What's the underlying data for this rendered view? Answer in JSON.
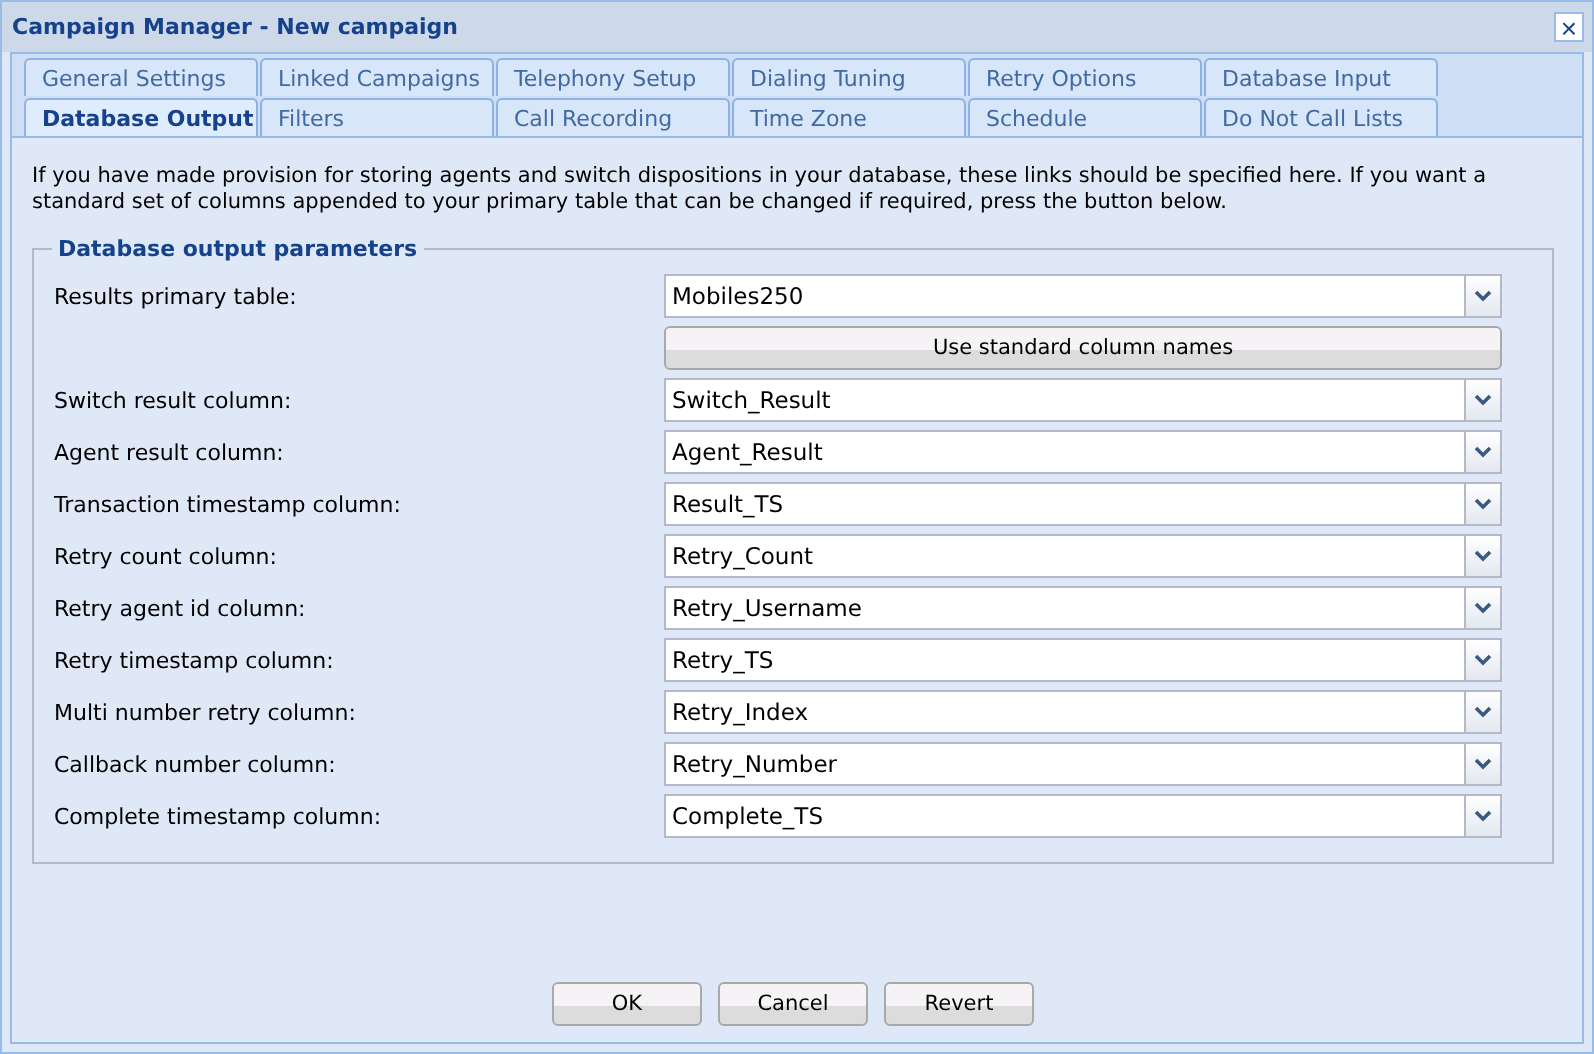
{
  "window": {
    "title": "Campaign Manager - New campaign",
    "close": "×"
  },
  "tab_rows": [
    [
      {
        "label": "General Settings",
        "selected": false
      },
      {
        "label": "Linked Campaigns",
        "selected": false
      },
      {
        "label": "Telephony Setup",
        "selected": false
      },
      {
        "label": "Dialing Tuning",
        "selected": false
      },
      {
        "label": "Retry Options",
        "selected": false
      },
      {
        "label": "Database Input",
        "selected": false
      }
    ],
    [
      {
        "label": "Database Output",
        "selected": true
      },
      {
        "label": "Filters",
        "selected": false
      },
      {
        "label": "Call Recording",
        "selected": false
      },
      {
        "label": "Time Zone",
        "selected": false
      },
      {
        "label": "Schedule",
        "selected": false
      },
      {
        "label": "Do Not Call Lists",
        "selected": false
      }
    ]
  ],
  "intro": "If you have made provision for storing agents and switch dispositions in your database, these links should be specified here. If you want a standard set of columns appended to your primary table that can be changed if required, press the button below.",
  "group": {
    "title": "Database output parameters",
    "fields": [
      {
        "kind": "select",
        "label": "Results primary table:",
        "value": "Mobiles250"
      },
      {
        "kind": "button",
        "label": "Use standard column names"
      },
      {
        "kind": "select",
        "label": "Switch result column:",
        "value": "Switch_Result"
      },
      {
        "kind": "select",
        "label": "Agent result column:",
        "value": "Agent_Result"
      },
      {
        "kind": "select",
        "label": "Transaction timestamp column:",
        "value": "Result_TS"
      },
      {
        "kind": "select",
        "label": "Retry count column:",
        "value": "Retry_Count"
      },
      {
        "kind": "select",
        "label": "Retry agent id column:",
        "value": "Retry_Username"
      },
      {
        "kind": "select",
        "label": "Retry timestamp column:",
        "value": "Retry_TS"
      },
      {
        "kind": "select",
        "label": "Multi number retry column:",
        "value": "Retry_Index"
      },
      {
        "kind": "select",
        "label": "Callback number column:",
        "value": "Retry_Number"
      },
      {
        "kind": "select",
        "label": "Complete timestamp column:",
        "value": "Complete_TS"
      }
    ]
  },
  "buttons": [
    "OK",
    "Cancel",
    "Revert"
  ]
}
